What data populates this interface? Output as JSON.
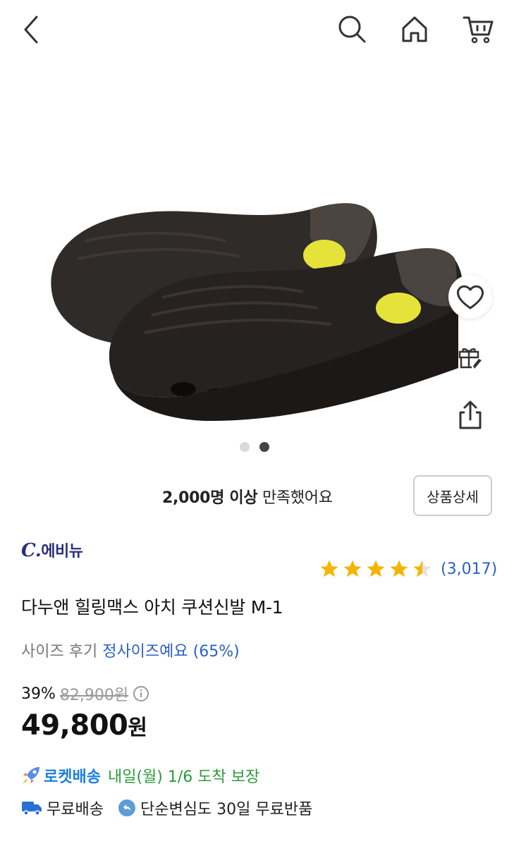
{
  "satisfaction": {
    "bold": "2,000명 이상",
    "rest": " 만족했어요"
  },
  "detail_button": "상품상세",
  "brand": {
    "mark": "C.",
    "name": "에비뉴"
  },
  "rating": {
    "value": 4.5,
    "count": "(3,017)"
  },
  "product_title": "다누앤 힐링맥스 아치 쿠션신발 M-1",
  "size_review": {
    "label": "사이즈 후기",
    "value": "정사이즈예요 (65%)"
  },
  "price": {
    "discount": "39%",
    "original": "82,900원",
    "current": "49,800",
    "won": "원"
  },
  "rocket": {
    "label": "로켓배송",
    "arrival": "내일(월) 1/6 도착 보장"
  },
  "shipping": {
    "free": "무료배송",
    "return": "단순변심도 30일 무료반품"
  },
  "gallery": {
    "total": 2,
    "active": 2
  },
  "colors": {
    "accent_blue": "#2a5fc8",
    "rocket_blue": "#1a7fe0",
    "green": "#2e9b3a",
    "star": "#f5b400"
  },
  "icons": [
    "back-arrow-icon",
    "search-icon",
    "home-icon",
    "cart-icon",
    "heart-icon",
    "gift-icon",
    "share-icon",
    "info-icon",
    "rocket-icon",
    "truck-icon",
    "return-icon",
    "star-icon"
  ]
}
